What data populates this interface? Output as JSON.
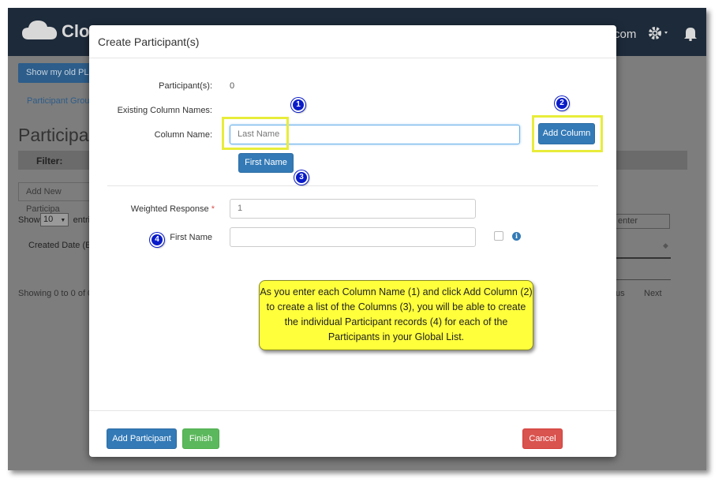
{
  "app": {
    "logo_text": "Clou",
    "nav_partial_text": "com"
  },
  "background": {
    "show_old_button": "Show my old PL",
    "tab_label": "Participant Group",
    "page_title": "Participan",
    "filter_label": "Filter:",
    "add_new_button": "Add New Participa",
    "show_label": "Show",
    "show_value": "10",
    "entries_label": "entri",
    "created_date_header": "Created Date (ET",
    "showing_text": "Showing 0 to 0 of 0",
    "search_placeholder": "enter",
    "previous_label": "us",
    "next_label": "Next"
  },
  "modal": {
    "title": "Create Participant(s)",
    "participants_label": "Participant(s):",
    "participants_value": "0",
    "existing_columns_label": "Existing Column Names:",
    "column_name_label": "Column Name:",
    "column_name_placeholder": "Last Name",
    "add_column_button": "Add Column",
    "column_chip": "First Name",
    "weighted_response_label": "Weighted Response",
    "required_marker": "*",
    "weighted_response_value": "1",
    "first_name_label": "First Name",
    "first_name_value": "",
    "add_participant_button": "Add Participant",
    "finish_button": "Finish",
    "cancel_button": "Cancel"
  },
  "annotations": {
    "badge_1": "1",
    "badge_2": "2",
    "badge_3": "3",
    "badge_4": "4",
    "callout_text": "As you enter each Column Name (1) and click Add Column (2) to create a list of the Columns (3), you will be able to create the individual Participant records (4) for each of the Participants in your Global List."
  },
  "colors": {
    "navbar": "#1d2a3a",
    "primary": "#337ab7",
    "success": "#5cb85c",
    "danger": "#d9534f",
    "highlight": "#e8ec3a",
    "callout": "#ffff3c",
    "badge": "#0a1cc9"
  },
  "icons": {
    "logo": "cloud-icon",
    "settings": "gear-icon",
    "notifications": "bell-icon",
    "info": "info-icon",
    "sort": "sort-icon",
    "select_arrow": "caret-down-icon"
  }
}
